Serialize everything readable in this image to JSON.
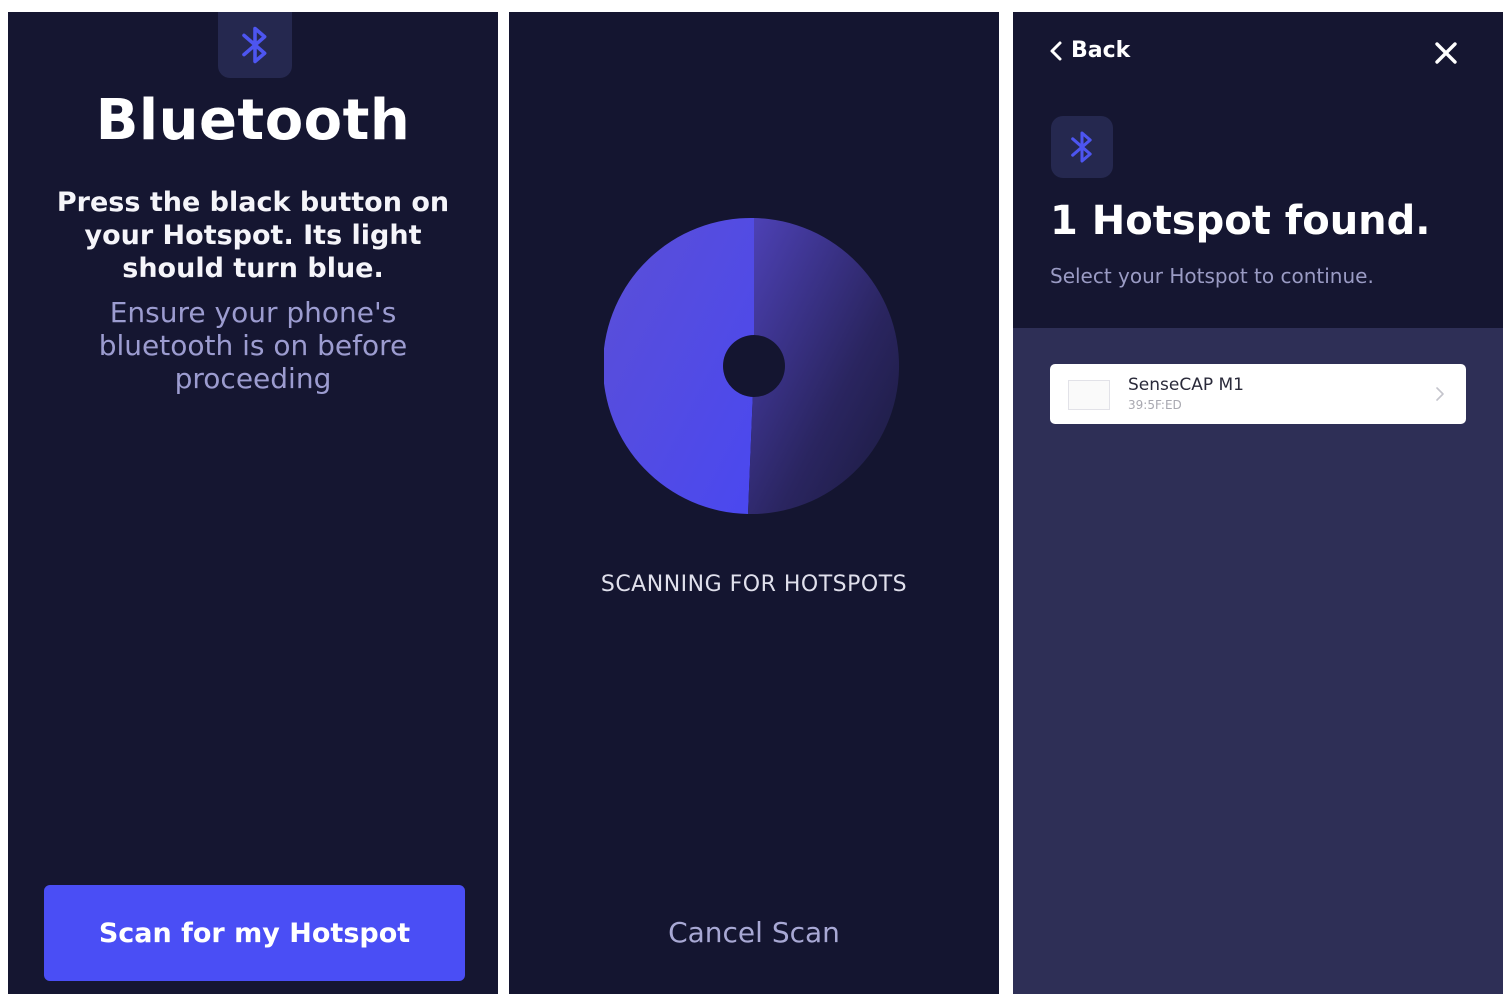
{
  "colors": {
    "panel_bg": "#151631",
    "accent": "#4a4ef5",
    "bluetooth_icon": "#4d55f0",
    "list_bg": "#2e2f56"
  },
  "screen1": {
    "icon": "bluetooth-icon",
    "title": "Bluetooth",
    "instruction": "Press the black button on your Hotspot. Its light should turn blue.",
    "note": "Ensure your phone's bluetooth is on before proceeding",
    "scan_button": "Scan for my Hotspot"
  },
  "screen2": {
    "icon": "radar-scan-icon",
    "status": "SCANNING FOR HOTSPOTS",
    "cancel_button": "Cancel Scan"
  },
  "screen3": {
    "back_label": "Back",
    "back_icon": "chevron-left-icon",
    "close_icon": "close-icon",
    "icon": "bluetooth-icon",
    "title": "1 Hotspot found.",
    "subtitle": "Select your Hotspot to continue.",
    "devices": [
      {
        "name": "SenseCAP M1",
        "id": "39:5F:ED",
        "chevron": "chevron-right-icon"
      }
    ]
  }
}
